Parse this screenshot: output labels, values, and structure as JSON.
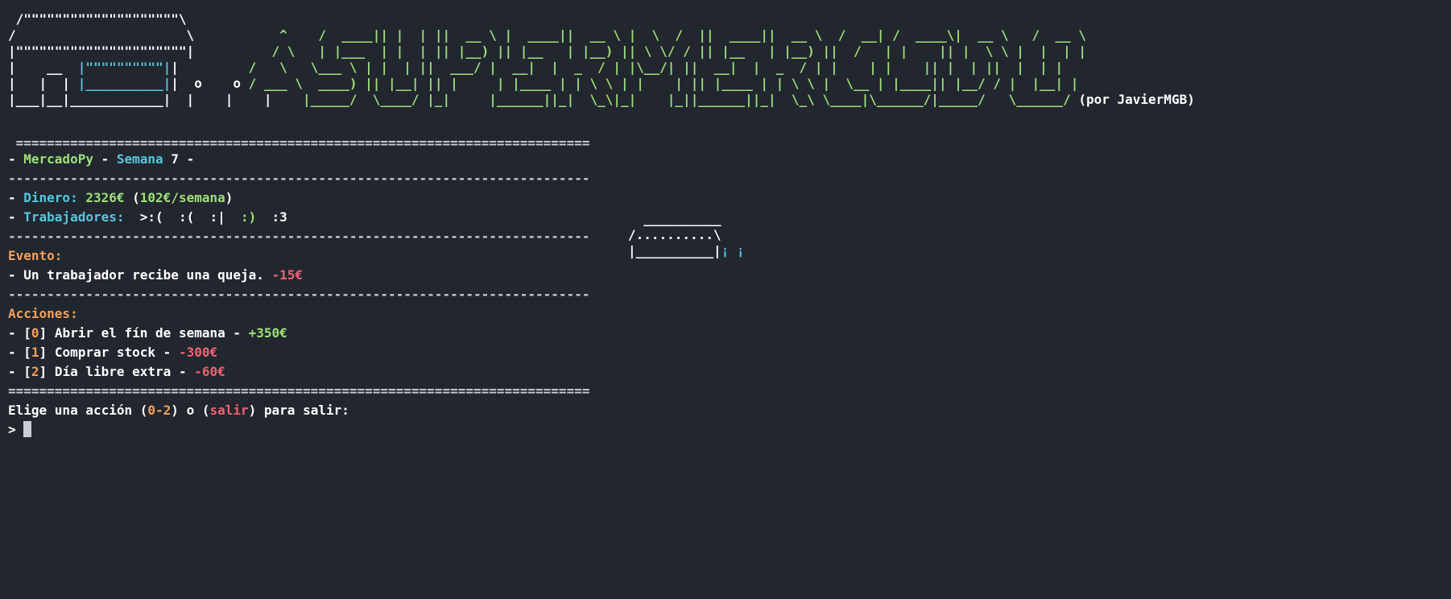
{
  "banner": {
    "author": "(por JavierMGB)"
  },
  "status": {
    "game_name": "MercadoPy",
    "week_label": "Semana",
    "week_number": "7",
    "money_label": "Dinero:",
    "money_value": "2326€",
    "income_value": "102€/semana",
    "workers_label": "Trabajadores:",
    "workers": [
      ">:(",
      ":(",
      ":|",
      ":)",
      ":3"
    ]
  },
  "event": {
    "heading": "Evento:",
    "text": "Un trabajador recibe una queja.",
    "amount": "-15€"
  },
  "actions": {
    "heading": "Acciones:",
    "items": [
      {
        "key": "0",
        "label": "Abrir el fín de semana",
        "amount": "+350€"
      },
      {
        "key": "1",
        "label": "Comprar stock",
        "amount": "-300€"
      },
      {
        "key": "2",
        "label": "Día libre extra",
        "amount": "-60€"
      }
    ]
  },
  "prompt": {
    "text_start": "Elige una acción (",
    "range": "0-2",
    "text_mid": ") o (",
    "exit_word": "salir",
    "text_end": ") para salir:",
    "caret": ">"
  },
  "colors": {
    "background": "#22262e",
    "cyan": "#56c8e0",
    "green": "#9ee07a",
    "orange": "#f3a15a",
    "red": "#f16270"
  }
}
